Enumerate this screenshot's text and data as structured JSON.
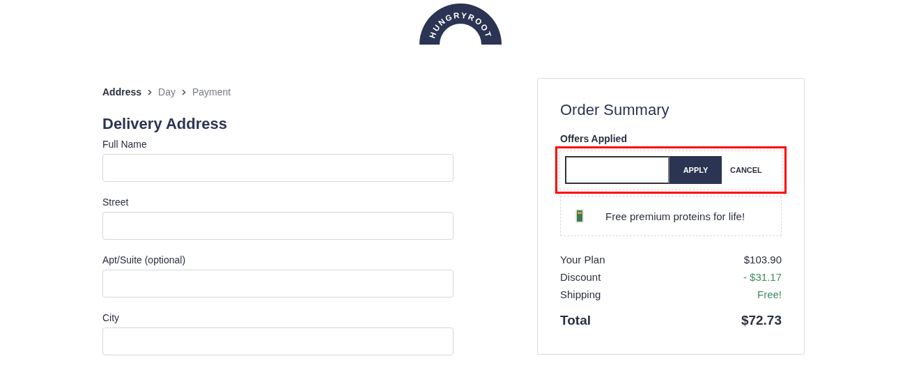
{
  "logo": {
    "text": "HUNGRYROOT"
  },
  "breadcrumb": [
    {
      "label": "Address",
      "selected": true
    },
    {
      "label": "Day",
      "selected": false
    },
    {
      "label": "Payment",
      "selected": false
    }
  ],
  "form": {
    "title": "Delivery Address",
    "fields": [
      {
        "label": "Full Name"
      },
      {
        "label": "Street"
      },
      {
        "label": "Apt/Suite (optional)"
      },
      {
        "label": "City"
      }
    ]
  },
  "summary": {
    "title": "Order Summary",
    "offers_label": "Offers Applied",
    "promo": {
      "highlighted": true,
      "apply": "APPLY",
      "cancel": "CANCEL"
    },
    "offer": {
      "text": "Free premium proteins for life!"
    },
    "lines": [
      {
        "label": "Your Plan",
        "value": "$103.90",
        "accent": false
      },
      {
        "label": "Discount",
        "value": "- $31.17",
        "accent": true
      },
      {
        "label": "Shipping",
        "value": "Free!",
        "accent": true
      }
    ],
    "total": {
      "label": "Total",
      "value": "$72.73"
    }
  }
}
